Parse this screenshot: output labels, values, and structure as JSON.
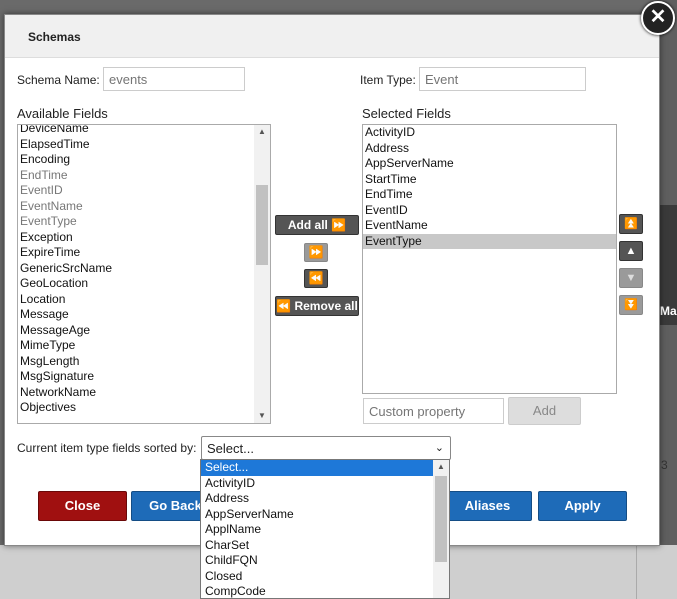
{
  "dialog": {
    "title": "Schemas"
  },
  "schema_name": {
    "label": "Schema Name:",
    "placeholder": "events"
  },
  "item_type": {
    "label": "Item Type:",
    "placeholder": "Event"
  },
  "available": {
    "label": "Available Fields",
    "items": [
      "DeviceName",
      "ElapsedTime",
      "Encoding",
      "EndTime",
      "EventID",
      "EventName",
      "EventType",
      "Exception",
      "ExpireTime",
      "GenericSrcName",
      "GeoLocation",
      "Location",
      "Message",
      "MessageAge",
      "MimeType",
      "MsgLength",
      "MsgSignature",
      "NetworkName",
      "Objectives"
    ],
    "dimmed": [
      "EndTime",
      "EventID",
      "EventName",
      "EventType"
    ]
  },
  "selected": {
    "label": "Selected Fields",
    "items": [
      "ActivityID",
      "Address",
      "AppServerName",
      "StartTime",
      "EndTime",
      "EventID",
      "EventName",
      "EventType"
    ],
    "highlighted": "EventType"
  },
  "middle_buttons": {
    "add_all": "Add all ⏩",
    "add_one": "⏩",
    "remove_one": "⏪",
    "remove_all": "⏪ Remove all"
  },
  "custom_property": {
    "placeholder": "Custom property",
    "add_label": "Add"
  },
  "sort": {
    "label": "Current item type fields sorted by:",
    "value": "Select..."
  },
  "dropdown_options": [
    "Select...",
    "ActivityID",
    "Address",
    "AppServerName",
    "ApplName",
    "CharSet",
    "ChildFQN",
    "Closed",
    "CompCode"
  ],
  "buttons": {
    "close": "Close",
    "go_back": "Go Back",
    "aliases": "Aliases",
    "apply": "Apply"
  },
  "background": {
    "strip_text": "Ma",
    "number": "3"
  },
  "colors": {
    "close_red": "#a01010",
    "blue": "#1e6bb8",
    "highlight": "#1e78d8"
  }
}
